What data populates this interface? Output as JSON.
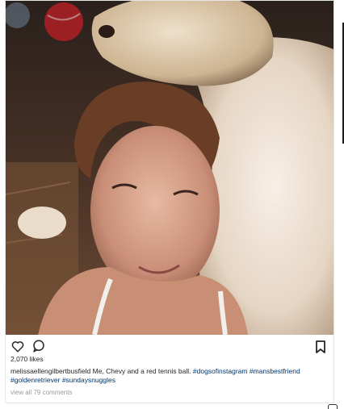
{
  "post": {
    "likes": "2,070 likes",
    "username": "melissaellengilbertbusfield",
    "caption_text": "Me, Chevy and a red tennis ball.",
    "hashtags_line1": [
      "#dogsofinstagram",
      "#mansbestfriend"
    ],
    "hashtags_line2": [
      "#goldenretriever",
      "#sundaysnuggles"
    ],
    "view_comments": "view all 79 comments"
  },
  "icons": {
    "like": "heart-outline-icon",
    "comment": "comment-bubble-icon",
    "save": "bookmark-icon"
  },
  "colors": {
    "hashtag": "#003569",
    "meta": "#999999",
    "text": "#262626"
  }
}
